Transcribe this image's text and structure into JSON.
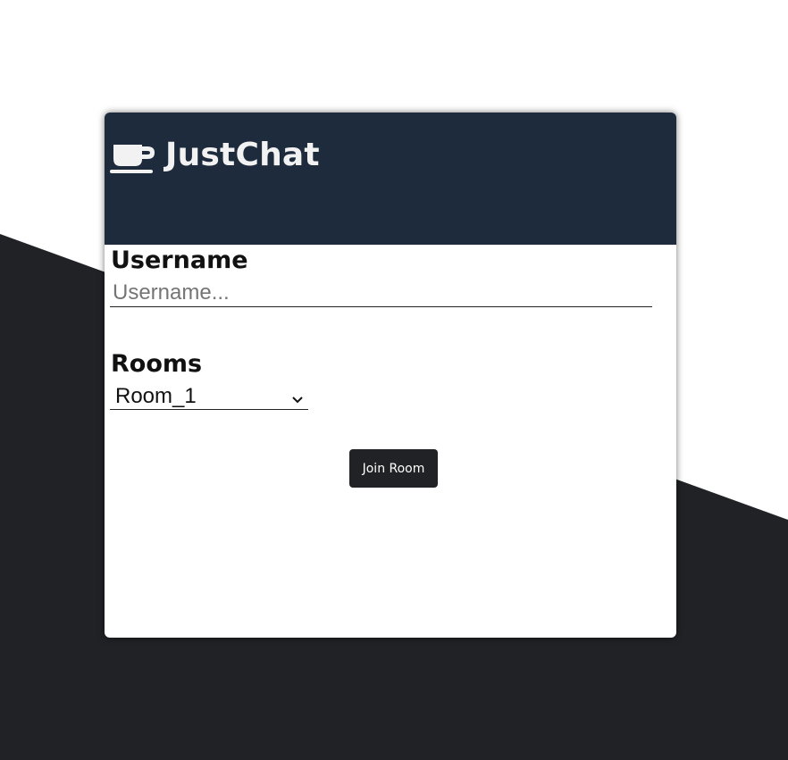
{
  "app": {
    "title": "JustChat",
    "logo_icon": "coffee-cup-icon"
  },
  "form": {
    "username_label": "Username",
    "username_placeholder": "Username...",
    "username_value": "",
    "rooms_label": "Rooms",
    "rooms_selected": "Room_1",
    "rooms_select_icon": "chevron-down-icon",
    "join_button_label": "Join Room"
  },
  "colors": {
    "header_bg": "#1e2b3c",
    "background_dark": "#212226",
    "button_bg": "#212226",
    "card_bg": "#ffffff"
  }
}
